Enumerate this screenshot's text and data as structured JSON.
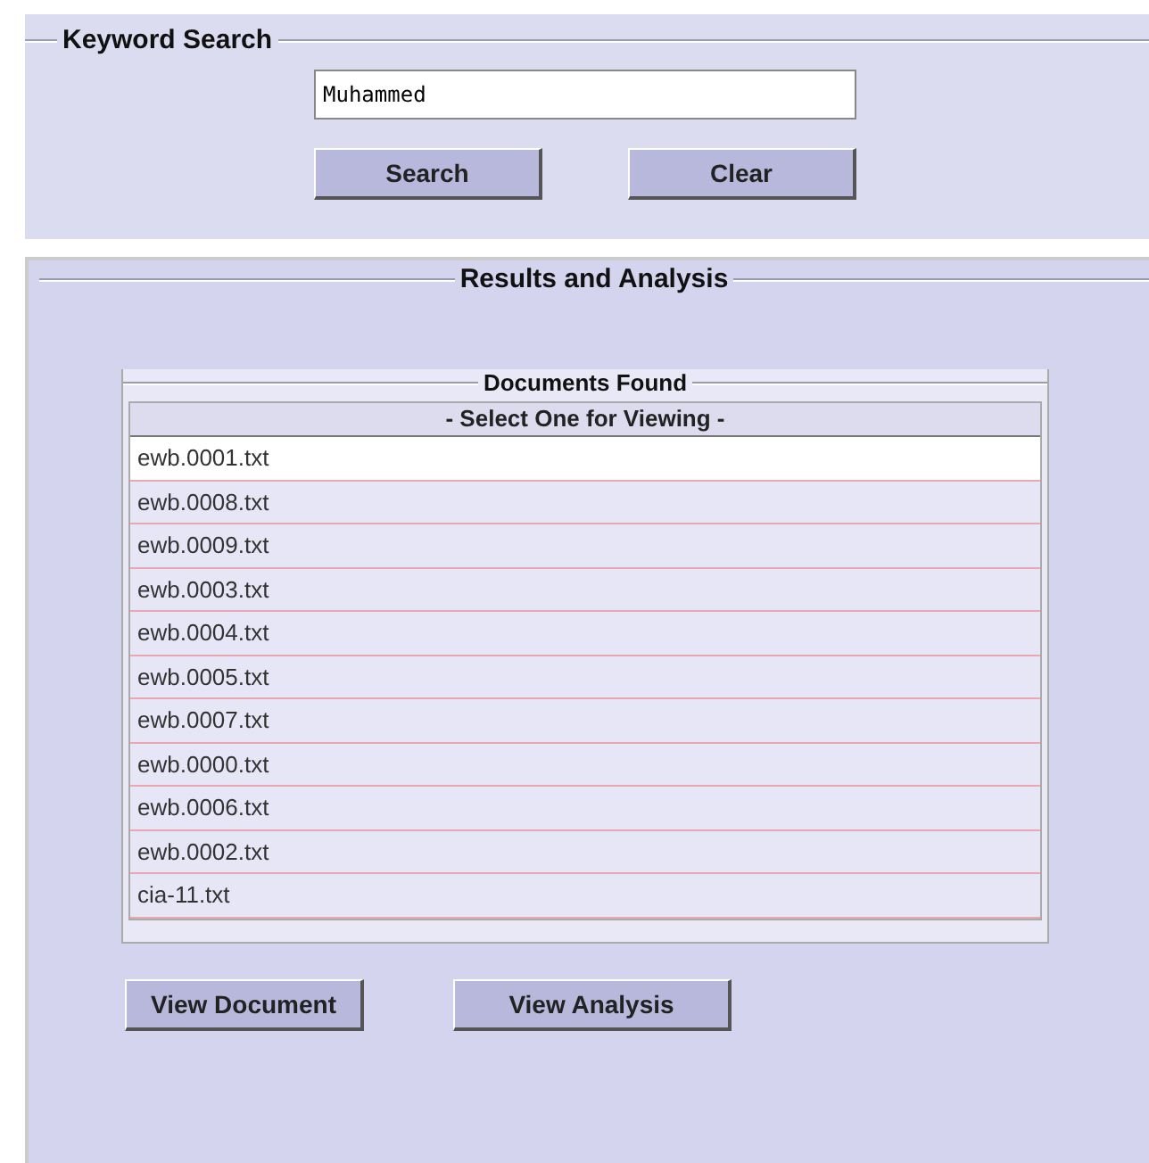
{
  "keyword_search": {
    "title": "Keyword Search",
    "query": "Muhammed",
    "buttons": [
      "Search",
      "Clear"
    ]
  },
  "results": {
    "title": "Results and Analysis",
    "documents": {
      "title": "Documents Found",
      "header": "- Select One for Viewing -",
      "items": [
        {
          "name": "ewb.0001.txt",
          "selected": true
        },
        {
          "name": "ewb.0008.txt",
          "selected": false
        },
        {
          "name": "ewb.0009.txt",
          "selected": false
        },
        {
          "name": "ewb.0003.txt",
          "selected": false
        },
        {
          "name": "ewb.0004.txt",
          "selected": false
        },
        {
          "name": "ewb.0005.txt",
          "selected": false
        },
        {
          "name": "ewb.0007.txt",
          "selected": false
        },
        {
          "name": "ewb.0000.txt",
          "selected": false
        },
        {
          "name": "ewb.0006.txt",
          "selected": false
        },
        {
          "name": "ewb.0002.txt",
          "selected": false
        },
        {
          "name": "cia-11.txt",
          "selected": false
        }
      ]
    },
    "buttons": [
      "View Document",
      "View Analysis"
    ]
  }
}
